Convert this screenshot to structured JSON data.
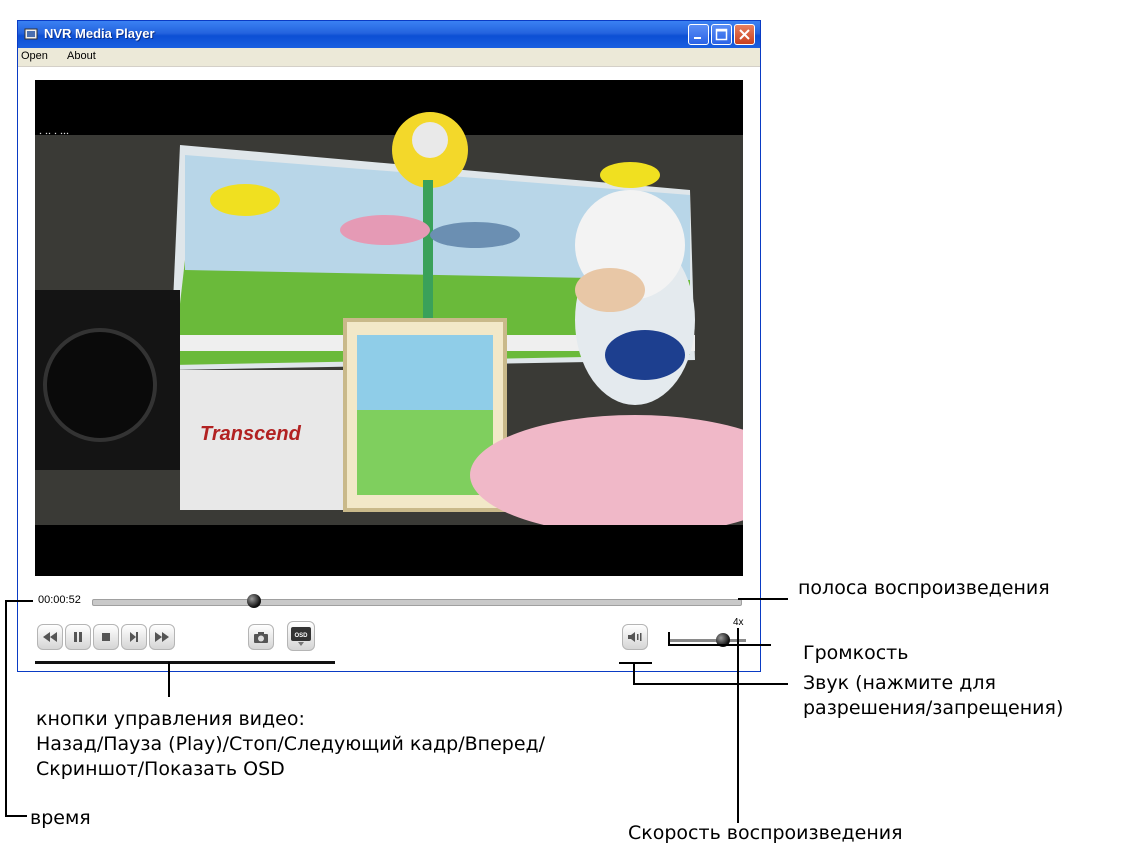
{
  "window": {
    "title": "NVR Media Player",
    "menu": [
      "Open",
      "About"
    ]
  },
  "player": {
    "time": "00:00:52",
    "playback_progress": 0.25,
    "volume_level": 0.7,
    "speed": "4x",
    "osd_button_label": "OSD",
    "controls": [
      {
        "name": "rewind",
        "icon": "double-left-arrow"
      },
      {
        "name": "pause",
        "icon": "pause-bars"
      },
      {
        "name": "stop",
        "icon": "stop-square"
      },
      {
        "name": "next-frame",
        "icon": "step-forward"
      },
      {
        "name": "fast-forward",
        "icon": "double-right-arrow"
      },
      {
        "name": "snapshot",
        "icon": "camera"
      },
      {
        "name": "show-osd",
        "icon": "osd"
      }
    ]
  },
  "video_scene": {
    "brand_text": "Transcend"
  },
  "annotations": {
    "playback_bar": "полоса воспроизведения",
    "volume": "Громкость",
    "sound_line1": "Звук (нажмите для",
    "sound_line2": "разрешения/запрещения)",
    "controls_line1": "кнопки управления видео:",
    "controls_line2": "Назад/Пауза (Play)/Стоп/Следующий кадр/Вперед/",
    "controls_line3": "Скриншот/Показать OSD",
    "time": "время",
    "speed": "Скорость воспроизведения"
  },
  "colors": {
    "titlebar": "#2463de",
    "close_button": "#c9401f",
    "video_background": "#000000"
  }
}
